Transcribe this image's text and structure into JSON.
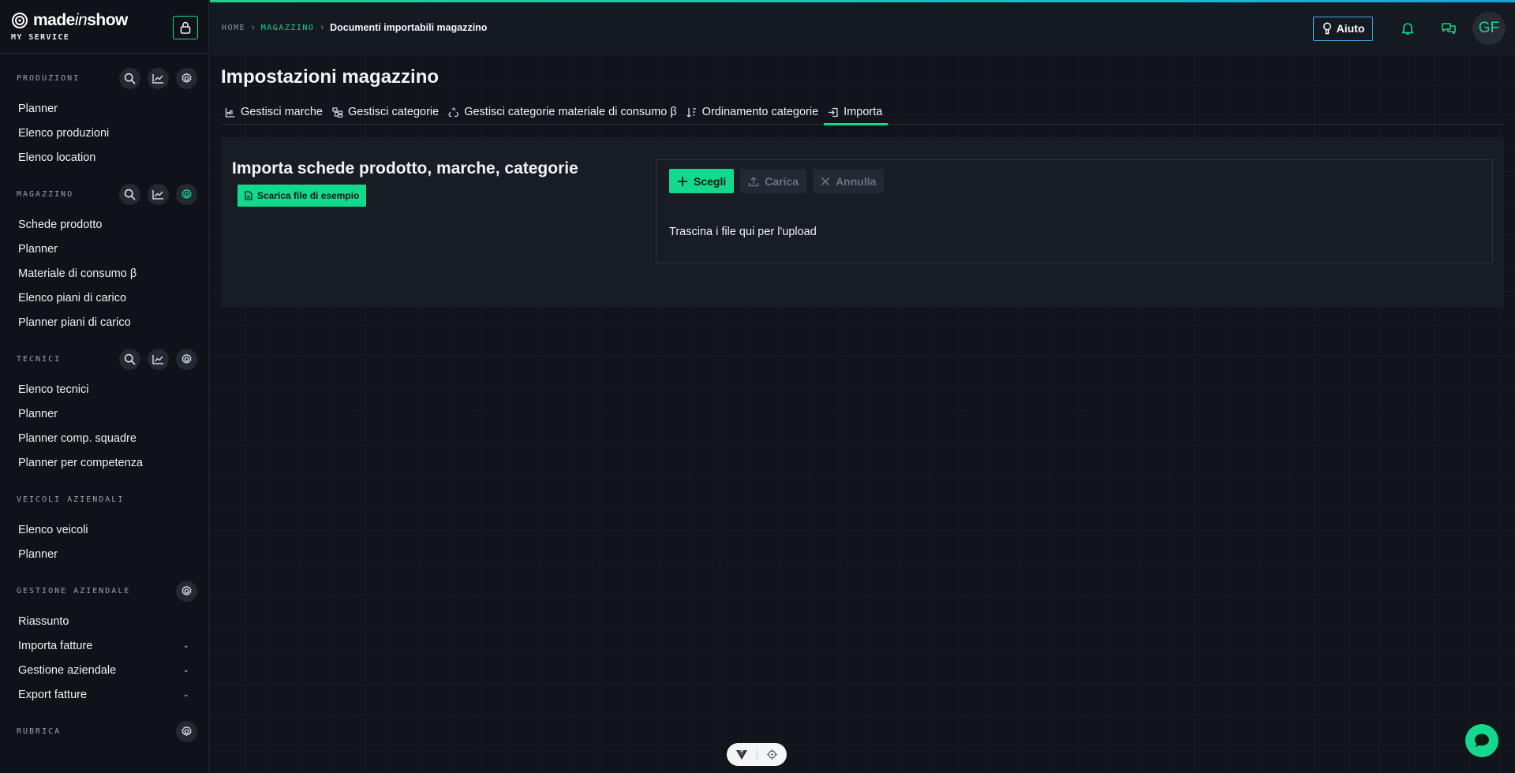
{
  "brand": {
    "name_prefix": "made",
    "name_italic": "in",
    "name_suffix": "show",
    "subtitle": "MY SERVICE"
  },
  "sidebar": {
    "sections": [
      {
        "title": "PRODUZIONI",
        "tools": [
          "search-icon",
          "trend-icon",
          "gear-icon"
        ],
        "active_tool": "",
        "items": [
          {
            "label": "Planner"
          },
          {
            "label": "Elenco produzioni"
          },
          {
            "label": "Elenco location"
          }
        ]
      },
      {
        "title": "MAGAZZINO",
        "tools": [
          "search-icon",
          "trend-icon",
          "gear-icon"
        ],
        "active_tool": "gear-icon",
        "items": [
          {
            "label": "Schede prodotto"
          },
          {
            "label": "Planner"
          },
          {
            "label": "Materiale di consumo β"
          },
          {
            "label": "Elenco piani di carico"
          },
          {
            "label": "Planner piani di carico"
          }
        ]
      },
      {
        "title": "TECNICI",
        "tools": [
          "search-icon",
          "trend-icon",
          "gear-icon"
        ],
        "active_tool": "",
        "items": [
          {
            "label": "Elenco tecnici"
          },
          {
            "label": "Planner"
          },
          {
            "label": "Planner comp. squadre"
          },
          {
            "label": "Planner per competenza"
          }
        ]
      },
      {
        "title": "VEICOLI AZIENDALI",
        "tools": [],
        "active_tool": "",
        "items": [
          {
            "label": "Elenco veicoli"
          },
          {
            "label": "Planner"
          }
        ]
      },
      {
        "title": "GESTIONE AZIENDALE",
        "tools": [
          "gear-icon"
        ],
        "active_tool": "",
        "items": [
          {
            "label": "Riassunto"
          },
          {
            "label": "Importa fatture",
            "expandable": true
          },
          {
            "label": "Gestione aziendale",
            "expandable": true
          },
          {
            "label": "Export fatture",
            "expandable": true
          }
        ]
      },
      {
        "title": "RUBRICA",
        "tools": [
          "gear-icon"
        ],
        "active_tool": "",
        "items": []
      }
    ]
  },
  "breadcrumb": {
    "home": "HOME",
    "section": "MAGAZZINO",
    "current": "Documenti importabili magazzino"
  },
  "topbar": {
    "help_label": "Aiuto",
    "avatar_initials": "GF"
  },
  "page": {
    "title": "Impostazioni magazzino"
  },
  "tabs": [
    {
      "label": "Gestisci marche",
      "icon": "chart-icon"
    },
    {
      "label": "Gestisci categorie",
      "icon": "tree-icon"
    },
    {
      "label": "Gestisci categorie materiale di consumo β",
      "icon": "recycle-icon"
    },
    {
      "label": "Ordinamento categorie",
      "icon": "sort-icon"
    },
    {
      "label": "Importa",
      "icon": "import-icon",
      "active": true
    }
  ],
  "import_panel": {
    "title": "Importa schede prodotto, marche, categorie",
    "sample_button": "Scarica file di esempio",
    "choose_button": "Scegli",
    "upload_button": "Carica",
    "cancel_button": "Annulla",
    "drop_text": "Trascina i file qui per l'upload"
  },
  "colors": {
    "accent": "#14d98c",
    "help_border": "#4aa8e0",
    "background": "#11141b",
    "sidebar": "#0f1218"
  }
}
